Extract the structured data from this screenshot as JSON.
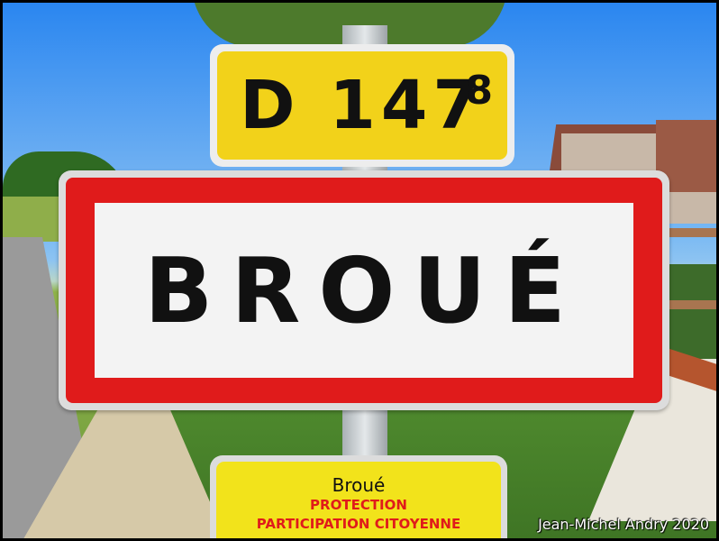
{
  "route_sign": {
    "code": "D 147",
    "suffix": "8"
  },
  "town_sign": {
    "name": "BROUÉ"
  },
  "info_sign": {
    "title": "Broué",
    "line1": "PROTECTION",
    "line2": "PARTICIPATION CITOYENNE"
  },
  "credit": "Jean-Michel Andry 2020",
  "colors": {
    "route_yellow": "#f2d21a",
    "sign_red": "#e01b1b",
    "sign_white": "#f3f3f3"
  }
}
